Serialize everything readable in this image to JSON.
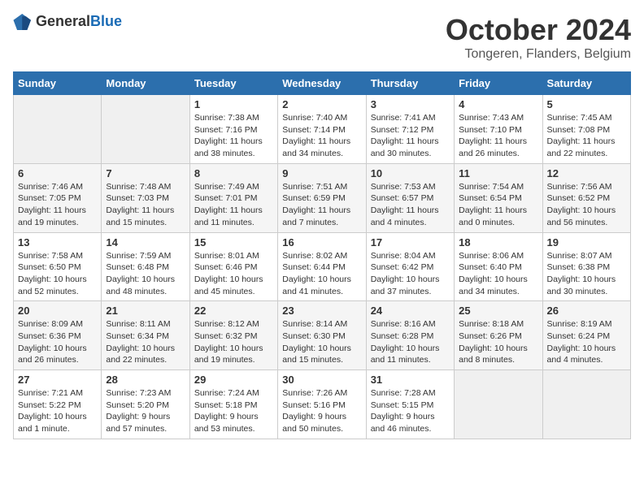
{
  "header": {
    "logo_general": "General",
    "logo_blue": "Blue",
    "month": "October 2024",
    "location": "Tongeren, Flanders, Belgium"
  },
  "weekdays": [
    "Sunday",
    "Monday",
    "Tuesday",
    "Wednesday",
    "Thursday",
    "Friday",
    "Saturday"
  ],
  "weeks": [
    [
      {
        "day": "",
        "sunrise": "",
        "sunset": "",
        "daylight": ""
      },
      {
        "day": "",
        "sunrise": "",
        "sunset": "",
        "daylight": ""
      },
      {
        "day": "1",
        "sunrise": "Sunrise: 7:38 AM",
        "sunset": "Sunset: 7:16 PM",
        "daylight": "Daylight: 11 hours and 38 minutes."
      },
      {
        "day": "2",
        "sunrise": "Sunrise: 7:40 AM",
        "sunset": "Sunset: 7:14 PM",
        "daylight": "Daylight: 11 hours and 34 minutes."
      },
      {
        "day": "3",
        "sunrise": "Sunrise: 7:41 AM",
        "sunset": "Sunset: 7:12 PM",
        "daylight": "Daylight: 11 hours and 30 minutes."
      },
      {
        "day": "4",
        "sunrise": "Sunrise: 7:43 AM",
        "sunset": "Sunset: 7:10 PM",
        "daylight": "Daylight: 11 hours and 26 minutes."
      },
      {
        "day": "5",
        "sunrise": "Sunrise: 7:45 AM",
        "sunset": "Sunset: 7:08 PM",
        "daylight": "Daylight: 11 hours and 22 minutes."
      }
    ],
    [
      {
        "day": "6",
        "sunrise": "Sunrise: 7:46 AM",
        "sunset": "Sunset: 7:05 PM",
        "daylight": "Daylight: 11 hours and 19 minutes."
      },
      {
        "day": "7",
        "sunrise": "Sunrise: 7:48 AM",
        "sunset": "Sunset: 7:03 PM",
        "daylight": "Daylight: 11 hours and 15 minutes."
      },
      {
        "day": "8",
        "sunrise": "Sunrise: 7:49 AM",
        "sunset": "Sunset: 7:01 PM",
        "daylight": "Daylight: 11 hours and 11 minutes."
      },
      {
        "day": "9",
        "sunrise": "Sunrise: 7:51 AM",
        "sunset": "Sunset: 6:59 PM",
        "daylight": "Daylight: 11 hours and 7 minutes."
      },
      {
        "day": "10",
        "sunrise": "Sunrise: 7:53 AM",
        "sunset": "Sunset: 6:57 PM",
        "daylight": "Daylight: 11 hours and 4 minutes."
      },
      {
        "day": "11",
        "sunrise": "Sunrise: 7:54 AM",
        "sunset": "Sunset: 6:54 PM",
        "daylight": "Daylight: 11 hours and 0 minutes."
      },
      {
        "day": "12",
        "sunrise": "Sunrise: 7:56 AM",
        "sunset": "Sunset: 6:52 PM",
        "daylight": "Daylight: 10 hours and 56 minutes."
      }
    ],
    [
      {
        "day": "13",
        "sunrise": "Sunrise: 7:58 AM",
        "sunset": "Sunset: 6:50 PM",
        "daylight": "Daylight: 10 hours and 52 minutes."
      },
      {
        "day": "14",
        "sunrise": "Sunrise: 7:59 AM",
        "sunset": "Sunset: 6:48 PM",
        "daylight": "Daylight: 10 hours and 48 minutes."
      },
      {
        "day": "15",
        "sunrise": "Sunrise: 8:01 AM",
        "sunset": "Sunset: 6:46 PM",
        "daylight": "Daylight: 10 hours and 45 minutes."
      },
      {
        "day": "16",
        "sunrise": "Sunrise: 8:02 AM",
        "sunset": "Sunset: 6:44 PM",
        "daylight": "Daylight: 10 hours and 41 minutes."
      },
      {
        "day": "17",
        "sunrise": "Sunrise: 8:04 AM",
        "sunset": "Sunset: 6:42 PM",
        "daylight": "Daylight: 10 hours and 37 minutes."
      },
      {
        "day": "18",
        "sunrise": "Sunrise: 8:06 AM",
        "sunset": "Sunset: 6:40 PM",
        "daylight": "Daylight: 10 hours and 34 minutes."
      },
      {
        "day": "19",
        "sunrise": "Sunrise: 8:07 AM",
        "sunset": "Sunset: 6:38 PM",
        "daylight": "Daylight: 10 hours and 30 minutes."
      }
    ],
    [
      {
        "day": "20",
        "sunrise": "Sunrise: 8:09 AM",
        "sunset": "Sunset: 6:36 PM",
        "daylight": "Daylight: 10 hours and 26 minutes."
      },
      {
        "day": "21",
        "sunrise": "Sunrise: 8:11 AM",
        "sunset": "Sunset: 6:34 PM",
        "daylight": "Daylight: 10 hours and 22 minutes."
      },
      {
        "day": "22",
        "sunrise": "Sunrise: 8:12 AM",
        "sunset": "Sunset: 6:32 PM",
        "daylight": "Daylight: 10 hours and 19 minutes."
      },
      {
        "day": "23",
        "sunrise": "Sunrise: 8:14 AM",
        "sunset": "Sunset: 6:30 PM",
        "daylight": "Daylight: 10 hours and 15 minutes."
      },
      {
        "day": "24",
        "sunrise": "Sunrise: 8:16 AM",
        "sunset": "Sunset: 6:28 PM",
        "daylight": "Daylight: 10 hours and 11 minutes."
      },
      {
        "day": "25",
        "sunrise": "Sunrise: 8:18 AM",
        "sunset": "Sunset: 6:26 PM",
        "daylight": "Daylight: 10 hours and 8 minutes."
      },
      {
        "day": "26",
        "sunrise": "Sunrise: 8:19 AM",
        "sunset": "Sunset: 6:24 PM",
        "daylight": "Daylight: 10 hours and 4 minutes."
      }
    ],
    [
      {
        "day": "27",
        "sunrise": "Sunrise: 7:21 AM",
        "sunset": "Sunset: 5:22 PM",
        "daylight": "Daylight: 10 hours and 1 minute."
      },
      {
        "day": "28",
        "sunrise": "Sunrise: 7:23 AM",
        "sunset": "Sunset: 5:20 PM",
        "daylight": "Daylight: 9 hours and 57 minutes."
      },
      {
        "day": "29",
        "sunrise": "Sunrise: 7:24 AM",
        "sunset": "Sunset: 5:18 PM",
        "daylight": "Daylight: 9 hours and 53 minutes."
      },
      {
        "day": "30",
        "sunrise": "Sunrise: 7:26 AM",
        "sunset": "Sunset: 5:16 PM",
        "daylight": "Daylight: 9 hours and 50 minutes."
      },
      {
        "day": "31",
        "sunrise": "Sunrise: 7:28 AM",
        "sunset": "Sunset: 5:15 PM",
        "daylight": "Daylight: 9 hours and 46 minutes."
      },
      {
        "day": "",
        "sunrise": "",
        "sunset": "",
        "daylight": ""
      },
      {
        "day": "",
        "sunrise": "",
        "sunset": "",
        "daylight": ""
      }
    ]
  ]
}
